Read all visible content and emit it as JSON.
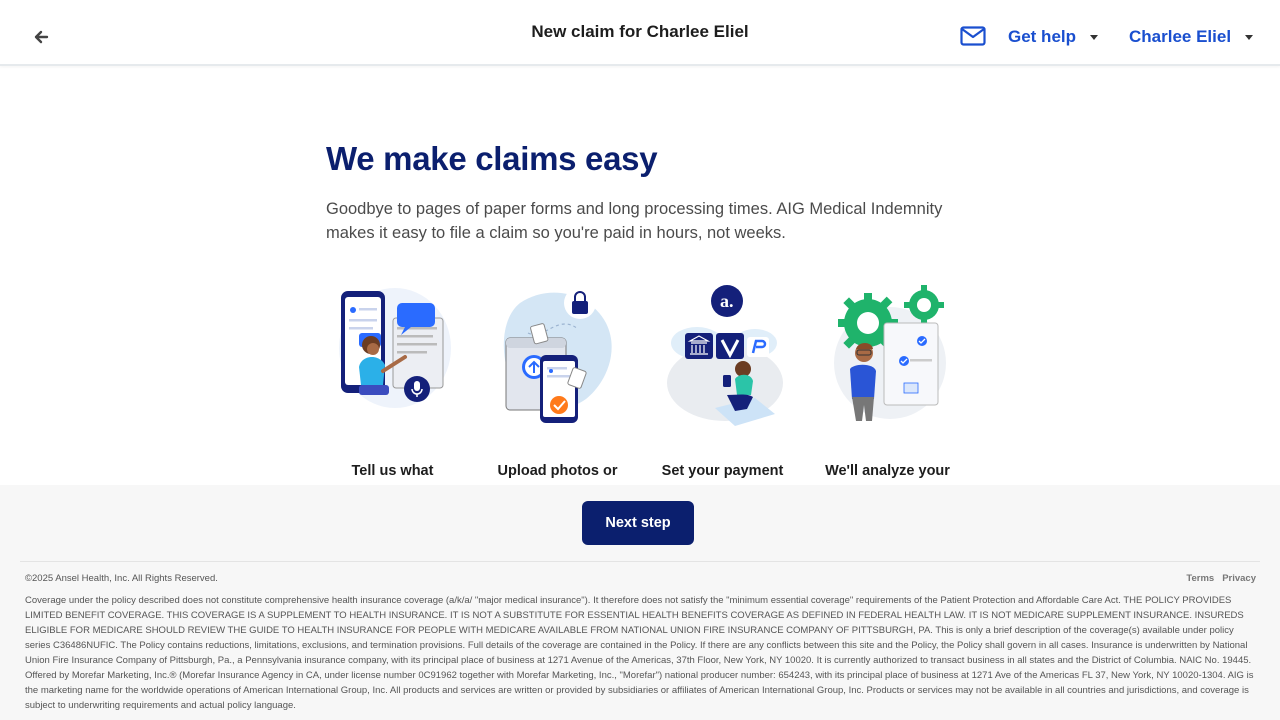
{
  "header": {
    "title": "New claim for Charlee Eliel",
    "back_icon": "arrow-left-icon",
    "mail_icon": "envelope-icon",
    "help_label": "Get help",
    "user_label": "Charlee Eliel",
    "accent_color": "#1a4fcf"
  },
  "main": {
    "title": "We make claims easy",
    "description": "Goodbye to pages of paper forms and long processing times. AIG Medical Indemnity makes it easy to file a claim so you're paid in hours, not weeks.",
    "steps": [
      {
        "label": "Tell us what",
        "illustration": "person-talking-to-phone-illustration"
      },
      {
        "label": "Upload photos or",
        "illustration": "upload-documents-illustration"
      },
      {
        "label": "Set your payment",
        "illustration": "payment-methods-illustration"
      },
      {
        "label": "We'll analyze your",
        "illustration": "review-gears-illustration"
      }
    ],
    "title_color": "#0b1f6e"
  },
  "footer": {
    "next_label": "Next step",
    "copyright": "©2025 Ansel Health, Inc. All Rights Reserved.",
    "links": {
      "terms": "Terms",
      "privacy": "Privacy"
    },
    "disclaimer": "Coverage under the policy described does not constitute comprehensive health insurance coverage (a/k/a/ \"major medical insurance\"). It therefore does not satisfy the \"minimum essential coverage\" requirements of the Patient Protection and Affordable Care Act. THE POLICY PROVIDES LIMITED BENEFIT COVERAGE. THIS COVERAGE IS A SUPPLEMENT TO HEALTH INSURANCE. IT IS NOT A SUBSTITUTE FOR ESSENTIAL HEALTH BENEFITS COVERAGE AS DEFINED IN FEDERAL HEALTH LAW. IT IS NOT MEDICARE SUPPLEMENT INSURANCE. INSUREDS ELIGIBLE FOR MEDICARE SHOULD REVIEW THE GUIDE TO HEALTH INSURANCE FOR PEOPLE WITH MEDICARE AVAILABLE FROM NATIONAL UNION FIRE INSURANCE COMPANY OF PITTSBURGH, PA. This is only a brief description of the coverage(s) available under policy series C36486NUFIC. The Policy contains reductions, limitations, exclusions, and termination provisions. Full details of the coverage are contained in the Policy. If there are any conflicts between this site and the Policy, the Policy shall govern in all cases. Insurance is underwritten by National Union Fire Insurance Company of Pittsburgh, Pa., a Pennsylvania insurance company, with its principal place of business at 1271 Avenue of the Americas, 37th Floor, New York, NY 10020. It is currently authorized to transact business in all states and the District of Columbia. NAIC No. 19445. Offered by Morefar Marketing, Inc.® (Morefar Insurance Agency in CA, under license number 0C91962 together with Morefar Marketing, Inc., \"Morefar\") national producer number: 654243, with its principal place of business at 1271 Ave of the Americas FL 37, New York, NY 10020-1304. AIG is the marketing name for the worldwide operations of American International Group, Inc. All products and services are written or provided by subsidiaries or affiliates of American International Group, Inc. Products or services may not be available in all countries and jurisdictions, and coverage is subject to underwriting requirements and actual policy language.",
    "button_color": "#0b1f6e"
  }
}
